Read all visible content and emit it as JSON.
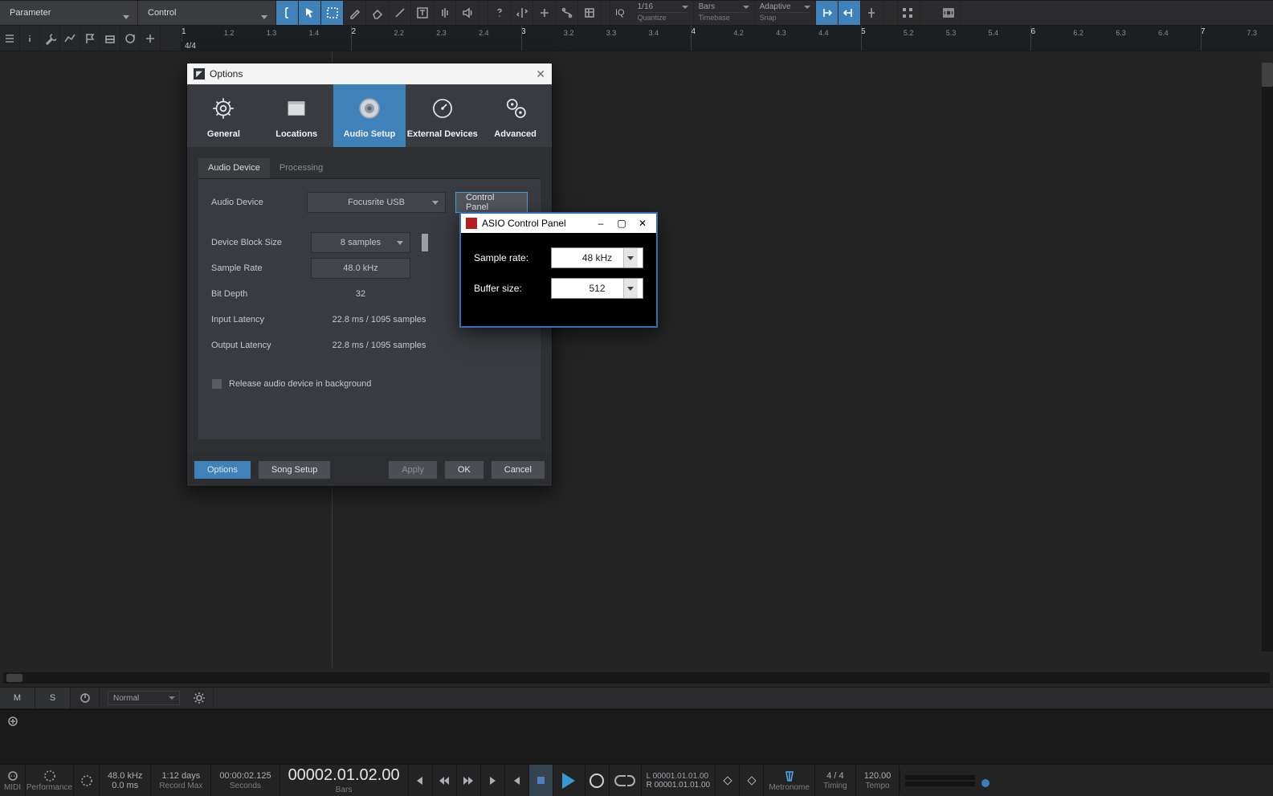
{
  "topbar": {
    "parameter_label": "Parameter",
    "control_label": "Control",
    "iq_label": "IQ",
    "quantize": {
      "value": "1/16",
      "caption": "Quantize"
    },
    "timebase": {
      "value": "Bars",
      "caption": "Timebase"
    },
    "snap": {
      "value": "Adaptive",
      "caption": "Snap"
    }
  },
  "ruler": {
    "timesig": "4/4",
    "majors": [
      "1",
      "2",
      "3",
      "4",
      "5",
      "6",
      "7"
    ],
    "minors": [
      "1.2",
      "1.3",
      "1.4",
      "2.2",
      "2.3",
      "2.4",
      "3.2",
      "3.3",
      "3.4",
      "4.2",
      "4.3",
      "4.4",
      "5.2",
      "5.3",
      "5.4",
      "6.2",
      "6.3",
      "6.4"
    ],
    "end": "7.3"
  },
  "ms_strip": {
    "m": "M",
    "s": "S",
    "mode": "Normal"
  },
  "options_dialog": {
    "title": "Options",
    "tabs": [
      "General",
      "Locations",
      "Audio Setup",
      "External Devices",
      "Advanced"
    ],
    "active_tab": "Audio Setup",
    "sub_tabs": [
      "Audio Device",
      "Processing"
    ],
    "active_sub_tab": "Audio Device",
    "rows": {
      "device_label": "Audio Device",
      "device_value": "Focusrite USB",
      "device_button": "Control Panel",
      "block_label": "Device Block Size",
      "block_value": "8 samples",
      "rate_label": "Sample Rate",
      "rate_value": "48.0 kHz",
      "bit_label": "Bit Depth",
      "bit_value": "32",
      "inlat_label": "Input Latency",
      "inlat_value": "22.8 ms / 1095 samples",
      "outlat_label": "Output Latency",
      "outlat_value": "22.8 ms / 1095 samples",
      "release_label": "Release audio device in background"
    },
    "footer": {
      "options": "Options",
      "song_setup": "Song Setup",
      "apply": "Apply",
      "ok": "OK",
      "cancel": "Cancel"
    }
  },
  "asio": {
    "title": "ASIO Control Panel",
    "rows": {
      "rate_label": "Sample rate:",
      "rate_value": "48 kHz",
      "buffer_label": "Buffer size:",
      "buffer_value": "512"
    }
  },
  "transport": {
    "midi_label": "MIDI",
    "perf_label": "Performance",
    "rate": "48.0 kHz",
    "latency": "0.0 ms",
    "rec_time": "1:12 days",
    "rec_label": "Record Max",
    "seconds": "00:00:02.125",
    "seconds_label": "Seconds",
    "bars": "00002.01.02.00",
    "bars_label": "Bars",
    "locator_L": "L 00001.01.01.00",
    "locator_R": "R 00001.01.01.00",
    "metronome_label": "Metronome",
    "timing_value": "4 / 4",
    "timing_label": "Timing",
    "tempo_value": "120.00",
    "tempo_label": "Tempo"
  }
}
